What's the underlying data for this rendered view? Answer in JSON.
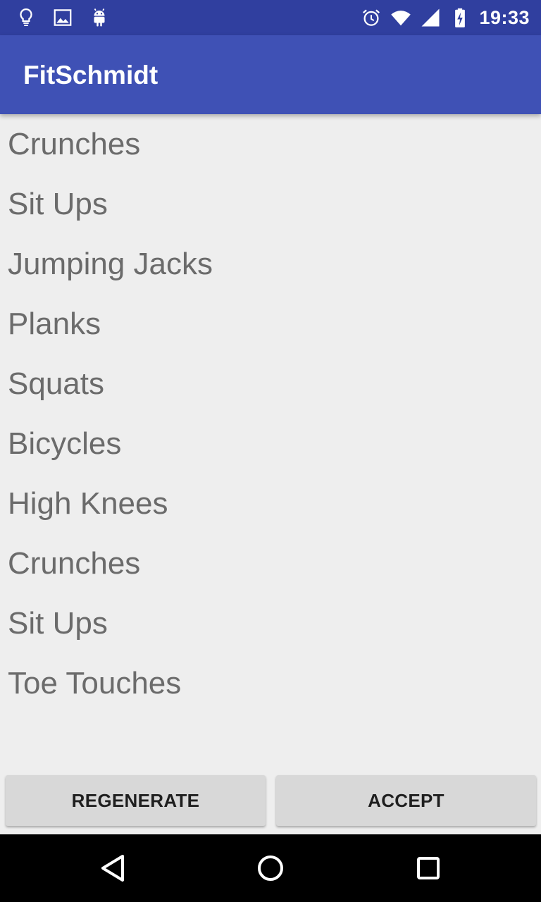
{
  "status_bar": {
    "time": "19:33",
    "left_icons": [
      "lightbulb-icon",
      "image-icon",
      "android-icon"
    ],
    "right_icons": [
      "alarm-icon",
      "wifi-icon",
      "signal-icon",
      "battery-charging-icon"
    ],
    "background_color": "#303f9f"
  },
  "app_bar": {
    "title": "FitSchmidt",
    "background_color": "#3f51b5"
  },
  "exercises": [
    "Crunches",
    "Sit Ups",
    "Jumping Jacks",
    "Planks",
    "Squats",
    "Bicycles",
    "High Knees",
    "Crunches",
    "Sit Ups",
    "Toe Touches"
  ],
  "buttons": {
    "regenerate_label": "REGENERATE",
    "accept_label": "ACCEPT"
  },
  "nav_bar": {
    "icons": [
      "back-icon",
      "home-icon",
      "recents-icon"
    ]
  }
}
